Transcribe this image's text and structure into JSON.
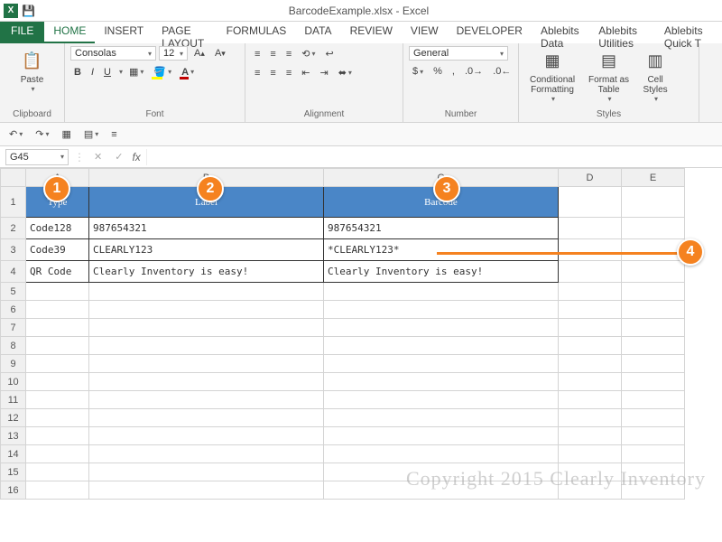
{
  "title": "BarcodeExample.xlsx - Excel",
  "tabs": {
    "file": "FILE",
    "home": "HOME",
    "insert": "INSERT",
    "pagelayout": "PAGE LAYOUT",
    "formulas": "FORMULAS",
    "data": "DATA",
    "review": "REVIEW",
    "view": "VIEW",
    "developer": "DEVELOPER",
    "abd": "Ablebits Data",
    "abu": "Ablebits Utilities",
    "abq": "Ablebits Quick T"
  },
  "ribbon": {
    "clipboard": {
      "paste": "Paste",
      "label": "Clipboard"
    },
    "font": {
      "name": "Consolas",
      "size": "12",
      "bold": "B",
      "italic": "I",
      "underline": "U",
      "label": "Font"
    },
    "alignment": {
      "label": "Alignment"
    },
    "number": {
      "format": "General",
      "label": "Number"
    },
    "styles": {
      "cond": "Conditional\nFormatting",
      "fmt": "Format as\nTable",
      "cell": "Cell\nStyles",
      "label": "Styles"
    }
  },
  "namebox": "G45",
  "columns": [
    "A",
    "B",
    "C",
    "D",
    "E"
  ],
  "headers": {
    "type": "Type",
    "label": "Label",
    "barcode": "Barcode"
  },
  "rows": [
    {
      "n": "1"
    },
    {
      "n": "2",
      "type": "Code128",
      "label": "987654321",
      "barcode": "987654321"
    },
    {
      "n": "3",
      "type": "Code39",
      "label": "CLEARLY123",
      "barcode": "*CLEARLY123*"
    },
    {
      "n": "4",
      "type": "QR Code",
      "label": "Clearly Inventory is easy!",
      "barcode": "Clearly Inventory is easy!"
    },
    {
      "n": "5"
    },
    {
      "n": "6"
    },
    {
      "n": "7"
    },
    {
      "n": "8"
    },
    {
      "n": "9"
    },
    {
      "n": "10"
    },
    {
      "n": "11"
    },
    {
      "n": "12"
    },
    {
      "n": "13"
    },
    {
      "n": "14"
    },
    {
      "n": "15"
    },
    {
      "n": "16"
    }
  ],
  "annotations": {
    "a1": "1",
    "a2": "2",
    "a3": "3",
    "a4": "4"
  },
  "watermark": "Copyright 2015 Clearly Inventory"
}
